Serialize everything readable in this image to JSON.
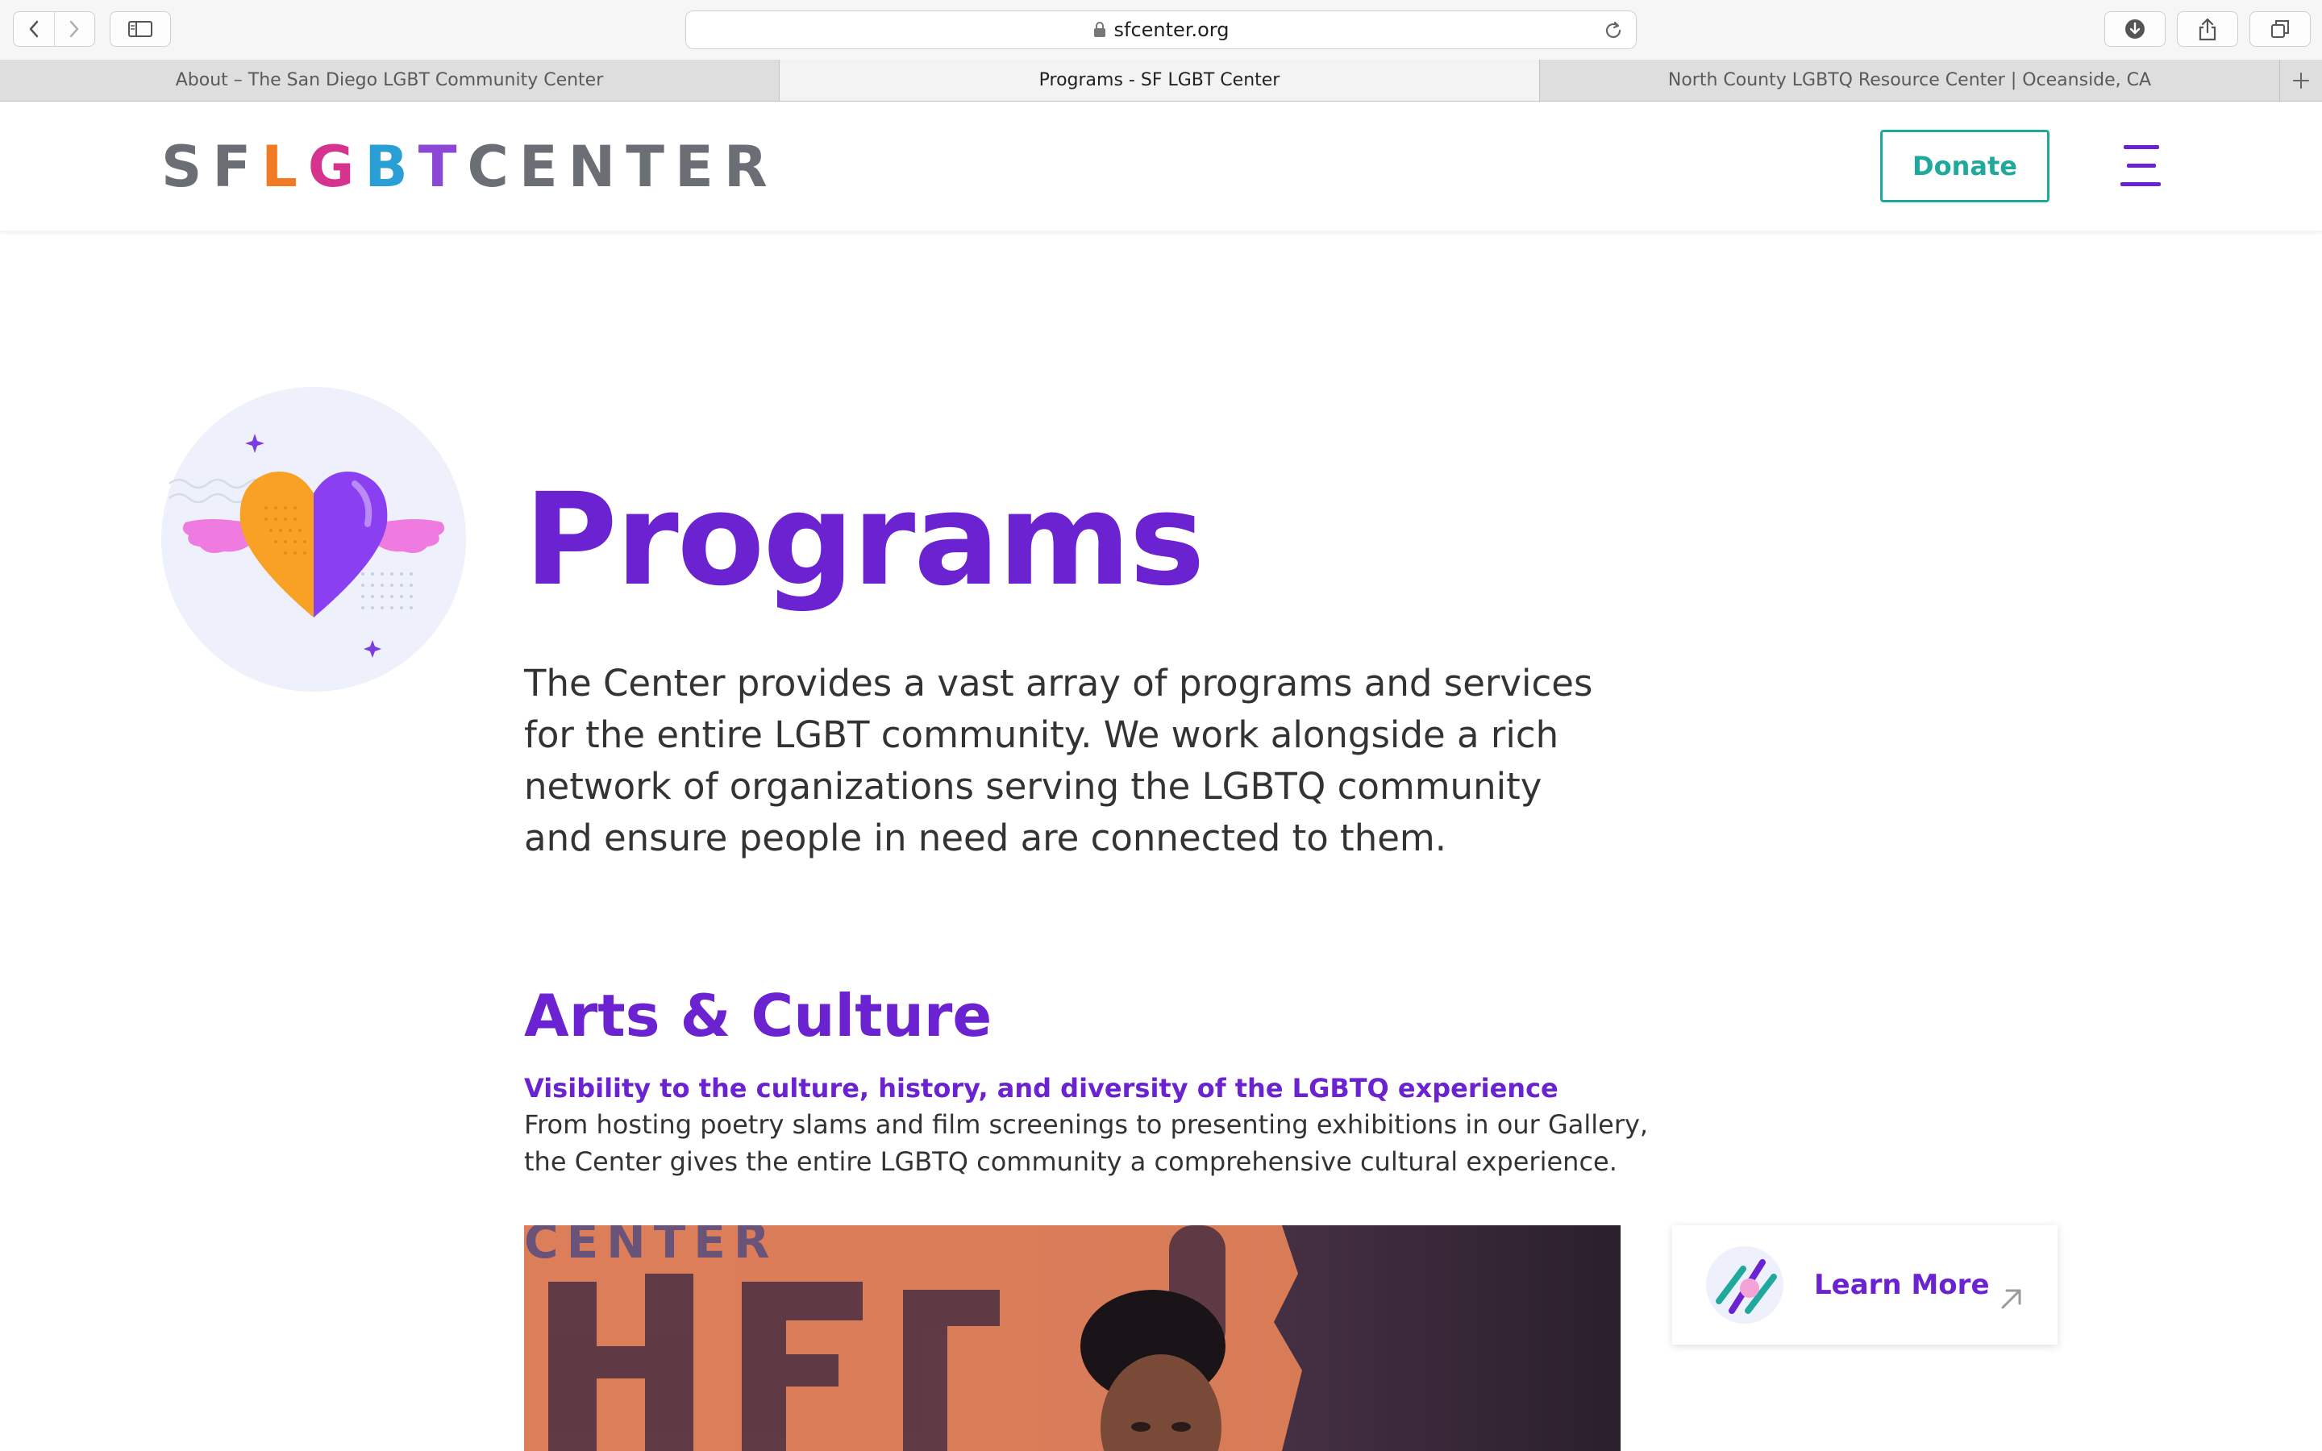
{
  "browser": {
    "url": "sfcenter.org",
    "tabs": [
      {
        "title": "About – The San Diego LGBT Community Center",
        "active": false
      },
      {
        "title": "Programs - SF LGBT Center",
        "active": true
      },
      {
        "title": "North County LGBTQ Resource Center | Oceanside, CA",
        "active": false
      }
    ],
    "icons": [
      "back-icon",
      "forward-icon",
      "sidebar-icon",
      "lock-icon",
      "reload-icon",
      "download-icon",
      "share-icon",
      "tabs-overview-icon",
      "new-tab-icon"
    ]
  },
  "site": {
    "logo_letters": [
      "S",
      "F",
      "L",
      "G",
      "B",
      "T",
      "C",
      "E",
      "N",
      "T",
      "E",
      "R"
    ],
    "logo_letter_colors": [
      "#6b6e75",
      "#6b6e75",
      "#f07b24",
      "#d6338f",
      "#2a9fd6",
      "#8d47d6",
      "#6b6e75",
      "#6b6e75",
      "#6b6e75",
      "#6b6e75",
      "#6b6e75",
      "#6b6e75"
    ],
    "donate_label": "Donate",
    "menu_icon": "hamburger-menu-icon"
  },
  "main": {
    "title": "Programs",
    "intro": "The Center provides a vast array of programs and services for the entire LGBT community. We work alongside a rich network of organizations serving the LGBTQ community and ensure people in need are connected to them.",
    "hero_icon": "winged-heart-icon",
    "section": {
      "title": "Arts & Culture",
      "subtitle": "Visibility to the culture, history, and diversity of the LGBTQ experience",
      "description": "From hosting poetry slams and film screenings to presenting exhibitions in our Gallery, the Center gives the entire LGBTQ community a comprehensive cultural experience.",
      "photo_text": "CENTER",
      "learn_more_label": "Learn More",
      "learn_more_icon": "slashes-icon",
      "arrow_icon": "arrow-up-right-icon"
    }
  },
  "colors": {
    "accent_purple": "#6b22d0",
    "teal": "#1fa89c",
    "text": "#333333"
  }
}
